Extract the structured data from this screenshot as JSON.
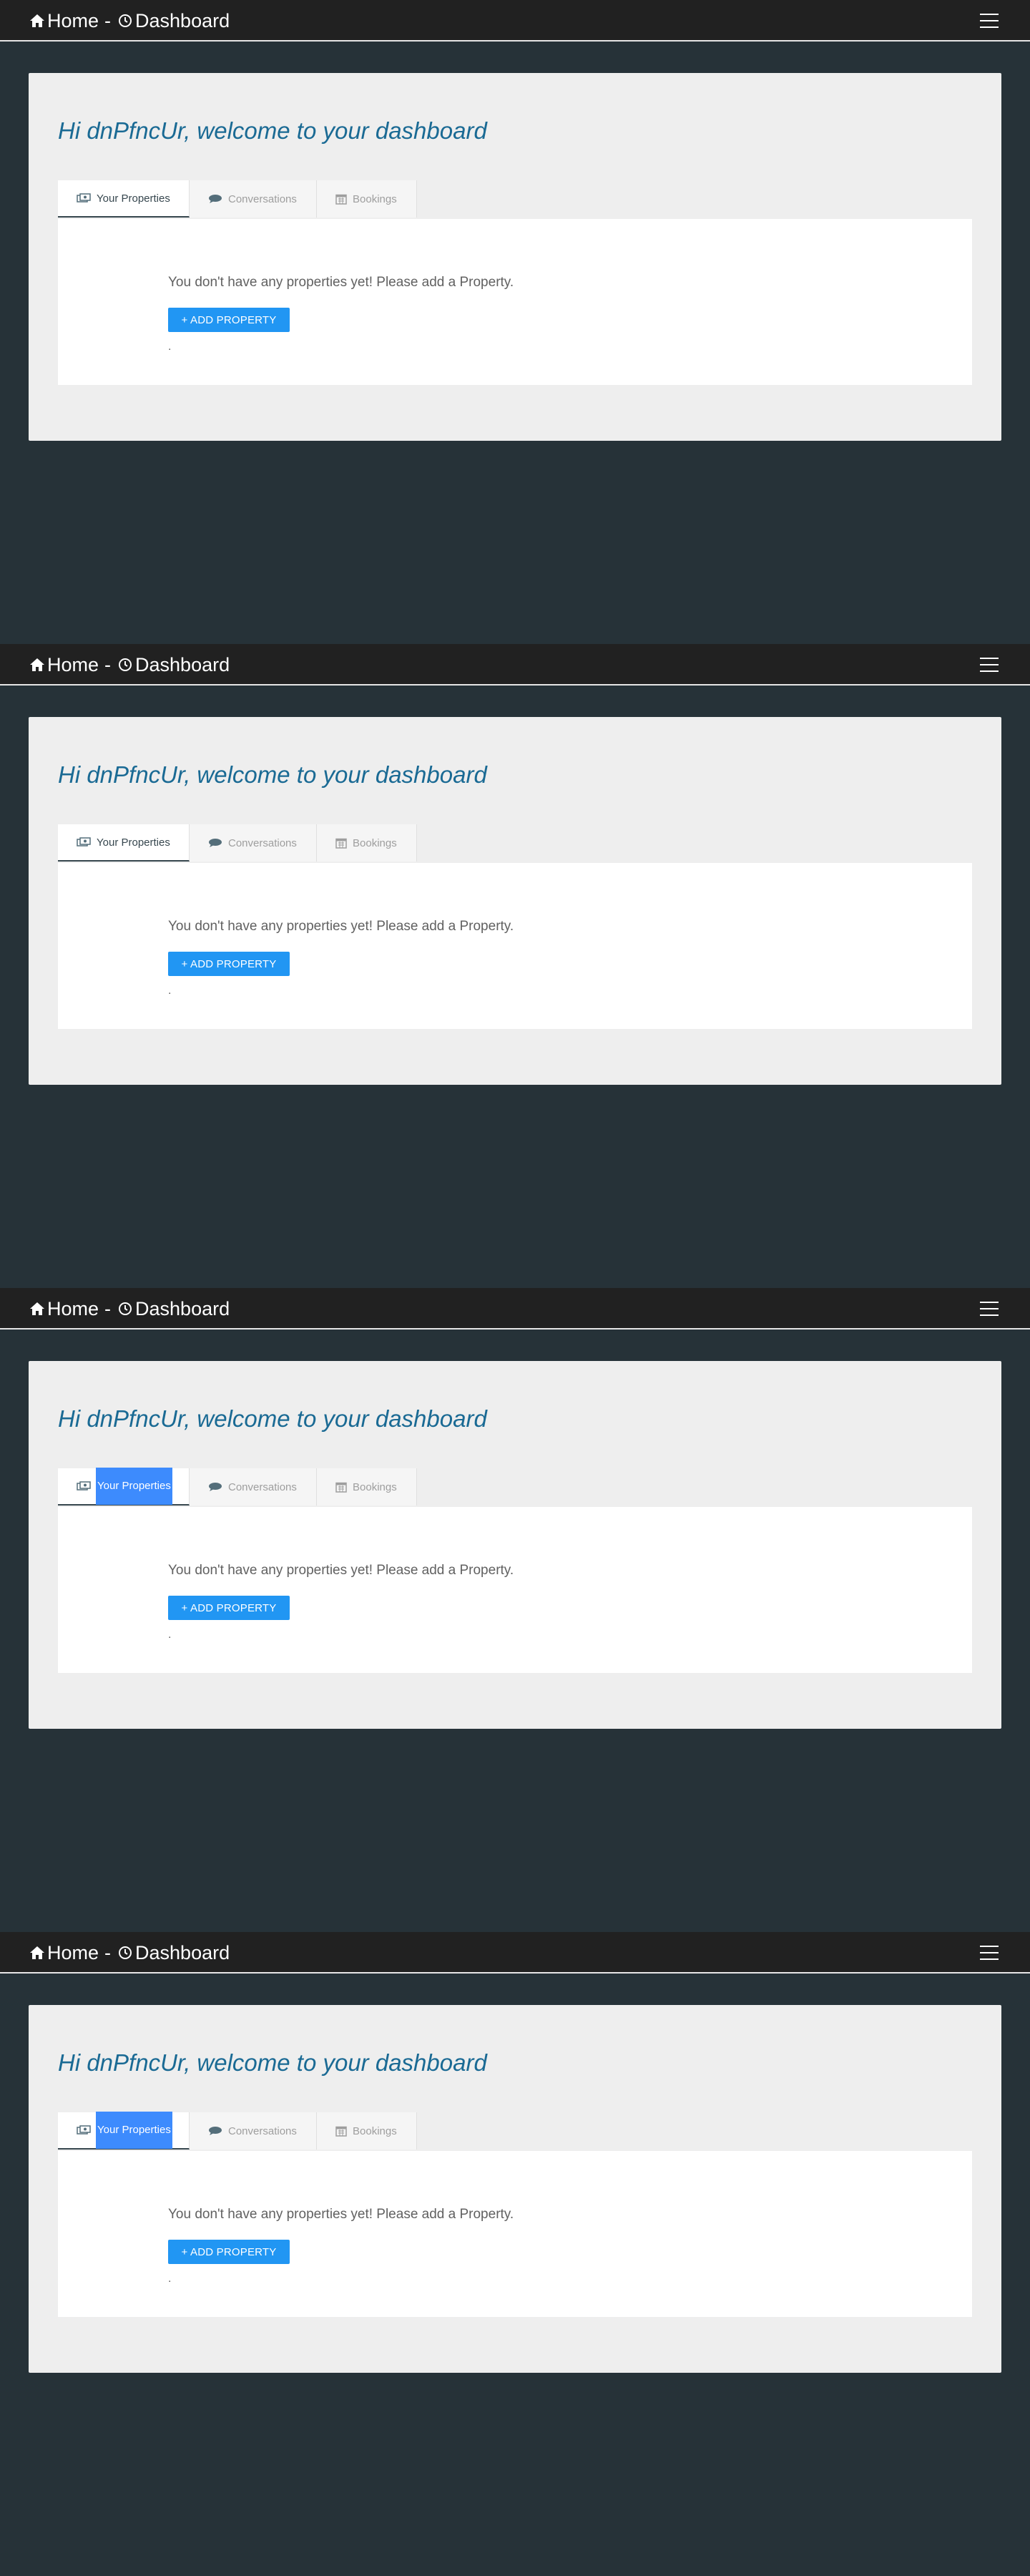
{
  "navbar": {
    "home_label": "Home",
    "separator": "-",
    "dashboard_label": "Dashboard"
  },
  "dashboard": {
    "welcome": "Hi dnPfncUr, welcome to your dashboard",
    "tabs": [
      {
        "label": "Your Properties",
        "icon": "money-icon"
      },
      {
        "label": "Conversations",
        "icon": "comment-icon"
      },
      {
        "label": "Bookings",
        "icon": "calendar-icon"
      }
    ],
    "empty_message": "You don't have any properties yet! Please add a Property.",
    "add_button": "+ ADD PROPERTY",
    "trailing": "."
  },
  "frames": [
    {
      "tab_highlight": false
    },
    {
      "tab_highlight": false
    },
    {
      "tab_highlight": true
    },
    {
      "tab_highlight": true
    }
  ],
  "colors": {
    "background": "#263238",
    "navbar": "#212121",
    "card": "#eeeeee",
    "welcome": "#1a6a94",
    "button": "#2196f3",
    "highlight": "#3d8bfd"
  }
}
